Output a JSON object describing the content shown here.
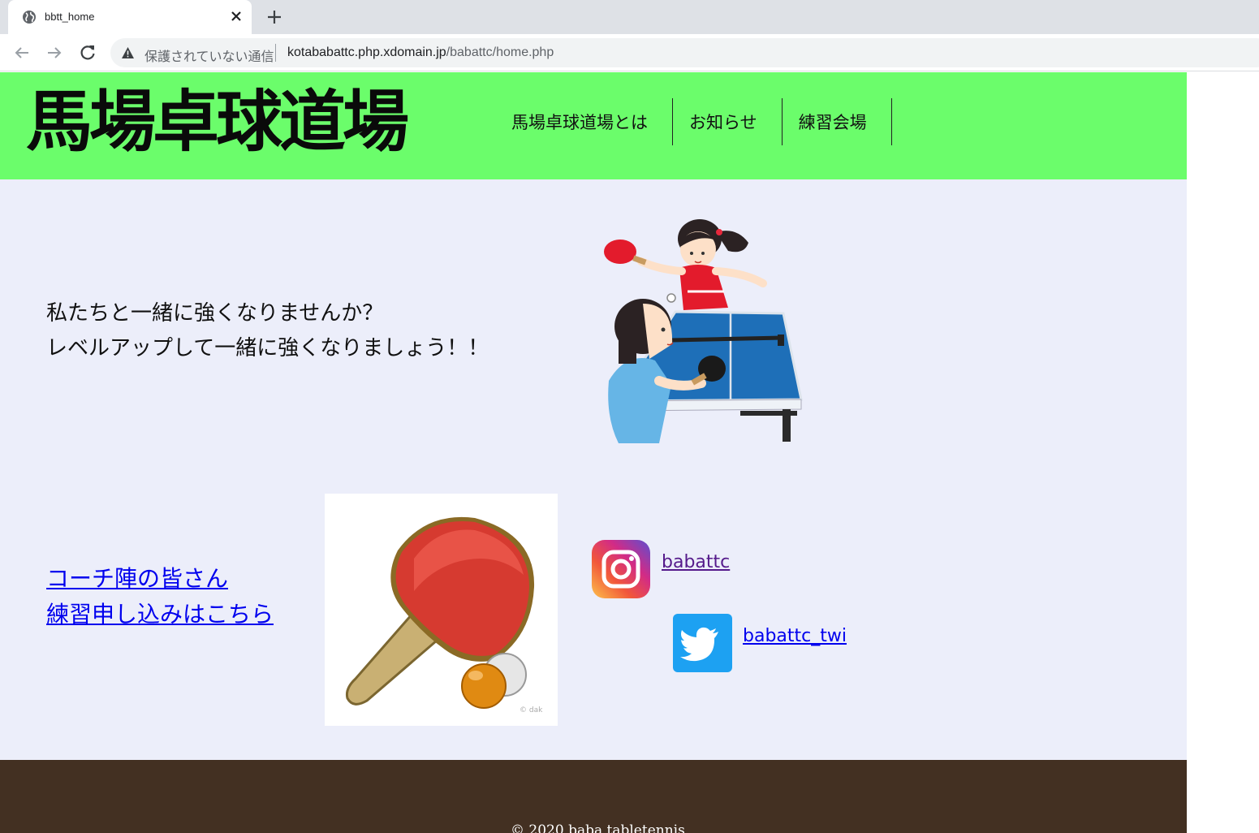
{
  "browser": {
    "tab_title": "bbtt_home",
    "insecure_label": "保護されていない通信",
    "url_host": "kotababattc.php.xdomain.jp",
    "url_path": "/babattc/home.php"
  },
  "header": {
    "site_title": "馬場卓球道場",
    "nav": [
      {
        "label": "馬場卓球道場とは"
      },
      {
        "label": "お知らせ"
      },
      {
        "label": "練習会場"
      }
    ]
  },
  "main": {
    "catchphrase": [
      "私たちと一緒に強くなりませんか？",
      "レベルアップして一緒に強くなりましょう！！"
    ],
    "links": [
      {
        "label": "コーチ陣の皆さん"
      },
      {
        "label": "練習申し込みはこちら"
      }
    ],
    "paddle_credit": "© dak",
    "social": {
      "instagram": {
        "handle": "babattc",
        "icon": "instagram-icon"
      },
      "twitter": {
        "handle": "babattc_twi",
        "icon": "twitter-icon"
      }
    }
  },
  "footer": {
    "copyright": "© 2020 baba tabletennis"
  },
  "colors": {
    "header_bg": "#6bfd6b",
    "page_bg": "#eceefa",
    "footer_bg": "#433022",
    "link": "#0000ee",
    "visited_link": "#551a8b"
  }
}
